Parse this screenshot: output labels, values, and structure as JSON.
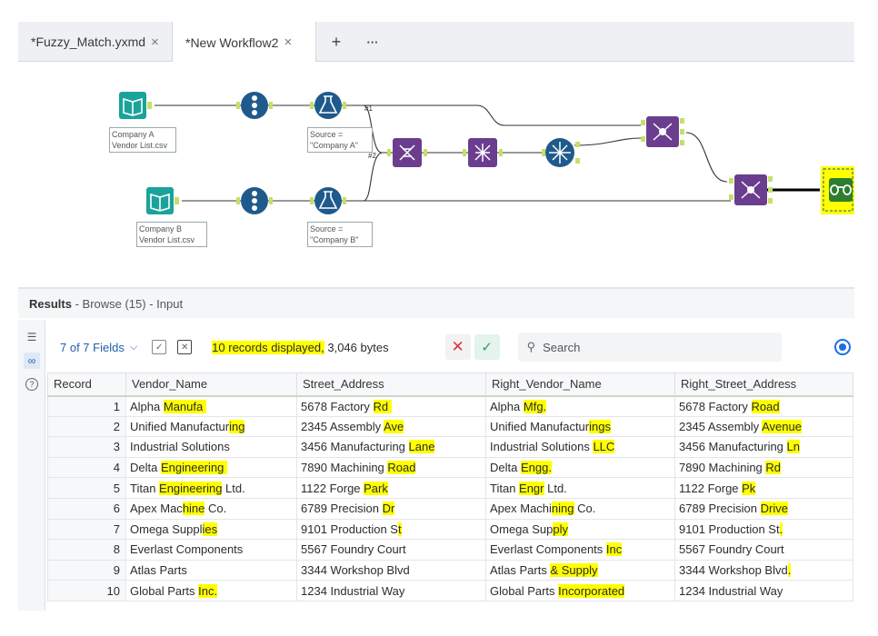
{
  "tabs": [
    {
      "label": "*Fuzzy_Match.yxmd",
      "close": "×"
    },
    {
      "label": "*New Workflow2",
      "close": "×"
    }
  ],
  "tab_actions": {
    "add": "+",
    "more": "···"
  },
  "workflow": {
    "labels": {
      "input_a": "Company A\nVendor List.csv",
      "input_b": "Company B\nVendor List.csv",
      "formula_a": "Source =\n\"Company A\"",
      "formula_b": "Source =\n\"Company B\""
    },
    "connection_tags": {
      "c1": "#1",
      "c2": "#2"
    },
    "colors": {
      "input": "#1aa39a",
      "select": "#1f5a8c",
      "formula": "#1f5a8c",
      "join": "#6b3d8f",
      "browse_highlight": "#ffff00",
      "browse": "#2f7d2f",
      "connector": "#c4e06b"
    }
  },
  "results": {
    "title": "Results",
    "subtitle": " - Browse (15) - Input"
  },
  "toolbar": {
    "fields_label": "7 of 7 Fields",
    "records_highlight": "10 records displayed,",
    "records_rest": " 3,046 bytes",
    "search_placeholder": "Search"
  },
  "table": {
    "headers": [
      "Record",
      "Vendor_Name",
      "Street_Address",
      "Right_Vendor_Name",
      "Right_Street_Address"
    ],
    "rows": [
      {
        "record": "1",
        "vendor": [
          "Alpha ",
          "Manufa",
          ""
        ],
        "vendor_pad": 4,
        "street": [
          "5678 Factory ",
          "Rd",
          ""
        ],
        "street_pad": 4,
        "rvendor": [
          "Alpha ",
          "Mfg.",
          ""
        ],
        "rstreet": [
          "5678 Factory ",
          "Road",
          ""
        ]
      },
      {
        "record": "2",
        "vendor": [
          "Unified Manufactur",
          "ing",
          ""
        ],
        "vendor_pad": 0,
        "street": [
          "2345 Assembly ",
          "Ave",
          ""
        ],
        "street_pad": 0,
        "rvendor": [
          "Unified Manufactur",
          "ings",
          ""
        ],
        "rstreet": [
          "2345 Assembly ",
          "Avenue",
          ""
        ]
      },
      {
        "record": "3",
        "vendor": [
          "Industrial Solutions",
          "",
          ""
        ],
        "vendor_pad": 26,
        "street": [
          "3456 Manufacturing ",
          "Lane",
          ""
        ],
        "street_pad": 0,
        "rvendor": [
          "Industrial Solutions ",
          "LLC",
          ""
        ],
        "rstreet": [
          "3456 Manufacturing ",
          "Ln",
          ""
        ]
      },
      {
        "record": "4",
        "vendor": [
          "Delta ",
          "Engineering",
          ""
        ],
        "vendor_pad": 4,
        "street": [
          "7890 Machining ",
          "Road",
          ""
        ],
        "street_pad": 0,
        "rvendor": [
          "Delta ",
          "Engg.",
          ""
        ],
        "rstreet": [
          "7890 Machining ",
          "Rd",
          ""
        ]
      },
      {
        "record": "5",
        "vendor": [
          "Titan ",
          "Engineering",
          " Ltd."
        ],
        "vendor_pad": 0,
        "street": [
          "1122 Forge ",
          "Park",
          ""
        ],
        "street_pad": 0,
        "rvendor": [
          "Titan ",
          "Engr",
          " Ltd."
        ],
        "rstreet": [
          "1122 Forge ",
          "Pk",
          ""
        ]
      },
      {
        "record": "6",
        "vendor": [
          "Apex Mac",
          "hine",
          " Co."
        ],
        "vendor_pad": 0,
        "street": [
          "6789 Precision ",
          "Dr",
          ""
        ],
        "street_pad": 0,
        "rvendor": [
          "Apex Machi",
          "ning",
          " Co."
        ],
        "rstreet": [
          "6789 Precision ",
          "Drive",
          ""
        ]
      },
      {
        "record": "7",
        "vendor": [
          "Omega Suppl",
          "ies",
          ""
        ],
        "vendor_pad": 0,
        "street": [
          "9101 Production S",
          "t",
          ""
        ],
        "street_pad": 0,
        "rvendor": [
          "Omega Sup",
          "ply",
          ""
        ],
        "rstreet": [
          "9101 Production St",
          ".",
          ""
        ]
      },
      {
        "record": "8",
        "vendor": [
          "Everlast Components",
          "",
          ""
        ],
        "vendor_pad": 16,
        "street": [
          "5567 Foundry Court",
          "",
          ""
        ],
        "street_pad": 0,
        "rvendor": [
          "Everlast Components ",
          "Inc",
          ""
        ],
        "rstreet": [
          "5567 Foundry Court",
          "",
          ""
        ]
      },
      {
        "record": "9",
        "vendor": [
          "Atlas Parts",
          "",
          ""
        ],
        "vendor_pad": 26,
        "street": [
          "3344 Workshop Blvd",
          "",
          ""
        ],
        "street_pad": 4,
        "rvendor": [
          "Atlas Parts ",
          "& Supply",
          ""
        ],
        "rstreet": [
          "3344 Workshop Blvd",
          ".",
          ""
        ]
      },
      {
        "record": "10",
        "vendor": [
          "Global Parts ",
          "Inc.",
          ""
        ],
        "vendor_pad": 0,
        "street": [
          "1234 Industrial Way",
          "",
          ""
        ],
        "street_pad": 0,
        "rvendor": [
          "Global Parts ",
          "Incorporated",
          ""
        ],
        "rstreet": [
          "1234 Industrial Way",
          "",
          ""
        ]
      }
    ]
  }
}
